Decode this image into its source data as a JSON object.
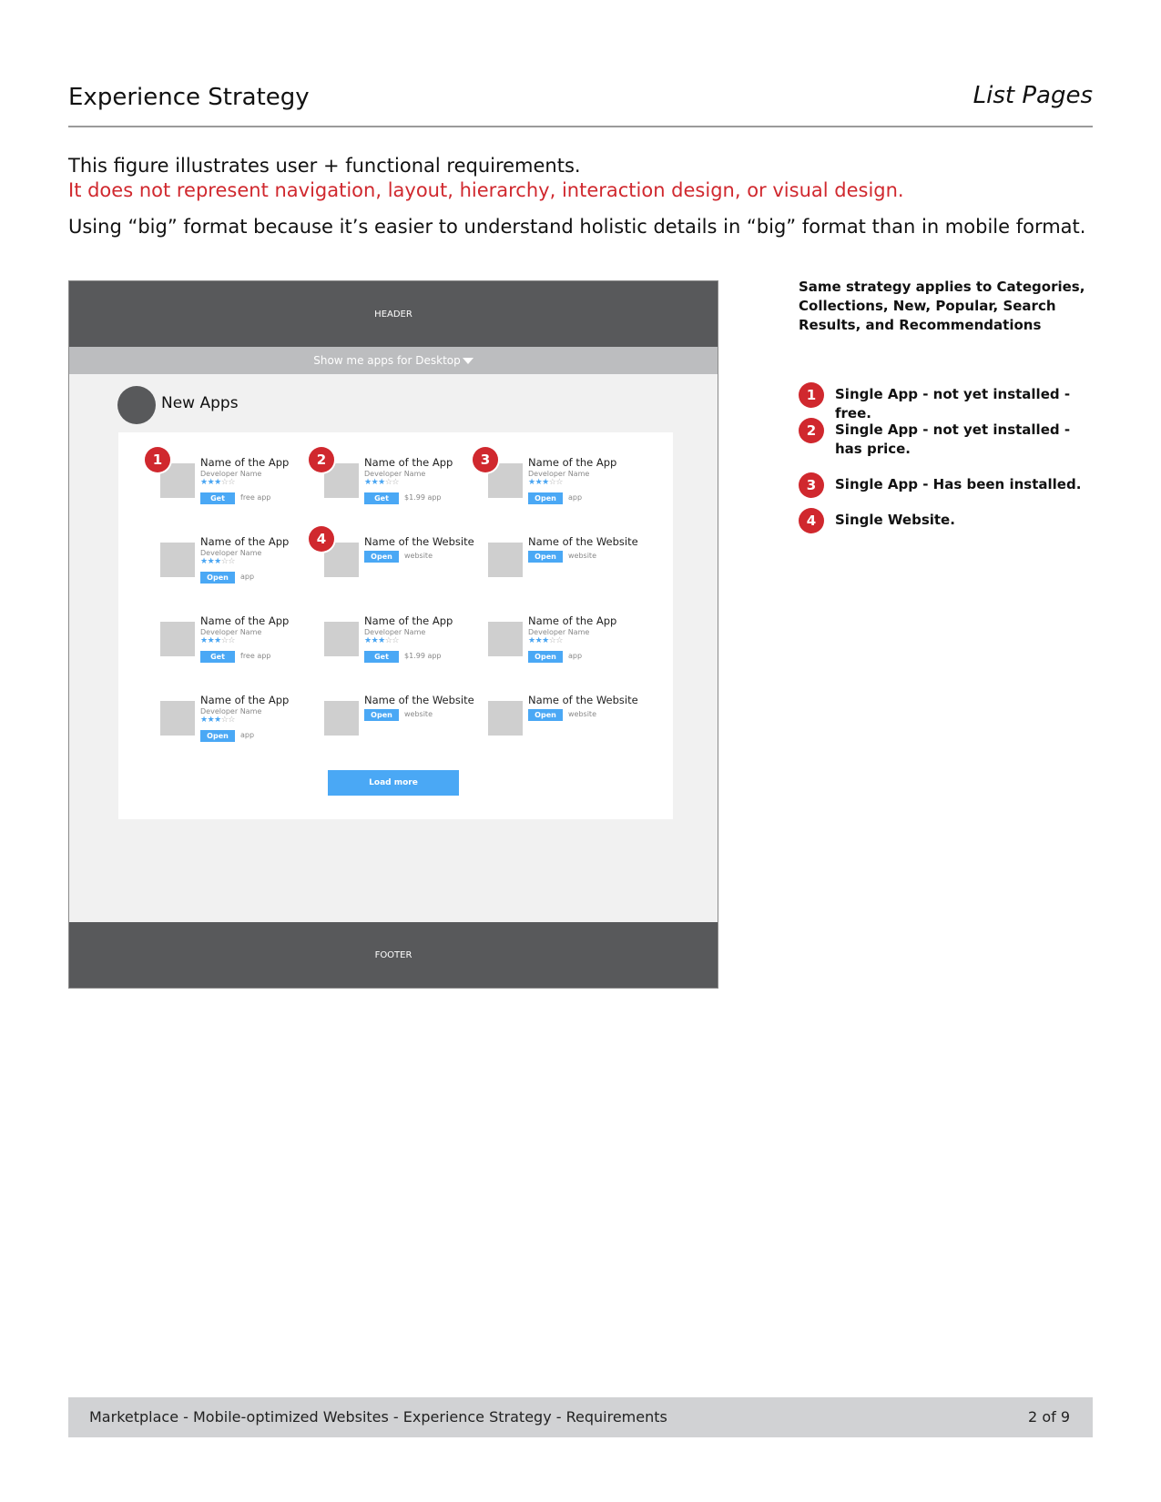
{
  "header": {
    "title": "Experience Strategy",
    "section": "List Pages"
  },
  "intro": {
    "line1": "This figure illustrates user + functional requirements.",
    "line2": "It does not represent navigation, layout, hierarchy, interaction design, or visual design.",
    "line3": "Using “big” format because it’s easier to understand holistic details in “big” format than in mobile format."
  },
  "wireframe": {
    "header_label": "HEADER",
    "filter_label": "Show me apps for Desktop",
    "section_title": "New Apps",
    "footer_label": "FOOTER",
    "load_more_label": "Load more",
    "cards": [
      {
        "name": "Name of the App",
        "developer": "Developer Name",
        "rating": 3,
        "button": "Get",
        "note": "free app",
        "badge": "1"
      },
      {
        "name": "Name of the App",
        "developer": "Developer Name",
        "rating": 3,
        "button": "Get",
        "note": "$1.99 app",
        "badge": "2"
      },
      {
        "name": "Name of the App",
        "developer": "Developer Name",
        "rating": 3,
        "button": "Open",
        "note": "app",
        "badge": "3"
      },
      {
        "name": "Name of the App",
        "developer": "Developer Name",
        "rating": 3,
        "button": "Open",
        "note": "app"
      },
      {
        "name": "Name of the Website",
        "button": "Open",
        "note": "website",
        "badge": "4"
      },
      {
        "name": "Name of the Website",
        "button": "Open",
        "note": "website"
      },
      {
        "name": "Name of the App",
        "developer": "Developer Name",
        "rating": 3,
        "button": "Get",
        "note": "free app"
      },
      {
        "name": "Name of the App",
        "developer": "Developer Name",
        "rating": 3,
        "button": "Get",
        "note": "$1.99 app"
      },
      {
        "name": "Name of the App",
        "developer": "Developer Name",
        "rating": 3,
        "button": "Open",
        "note": "app"
      },
      {
        "name": "Name of the App",
        "developer": "Developer Name",
        "rating": 3,
        "button": "Open",
        "note": "app"
      },
      {
        "name": "Name of the Website",
        "button": "Open",
        "note": "website"
      },
      {
        "name": "Name of the Website",
        "button": "Open",
        "note": "website"
      }
    ]
  },
  "side_note": "Same strategy applies to Categories, Collections, New, Popular, Search Results, and Recommendations",
  "legend": [
    {
      "number": "1",
      "text": "Single App - not yet installed - free."
    },
    {
      "number": "2",
      "text": "Single App - not yet installed - has price."
    },
    {
      "number": "3",
      "text": "Single App - Has been installed."
    },
    {
      "number": "4",
      "text": "Single Website."
    }
  ],
  "footer": {
    "text": "Marketplace - Mobile-optimized Websites - Experience Strategy - Requirements",
    "page": "2 of 9"
  },
  "colors": {
    "accent_red": "#d0282e",
    "button_blue": "#4aa8f5",
    "dark_gray": "#58595b"
  }
}
